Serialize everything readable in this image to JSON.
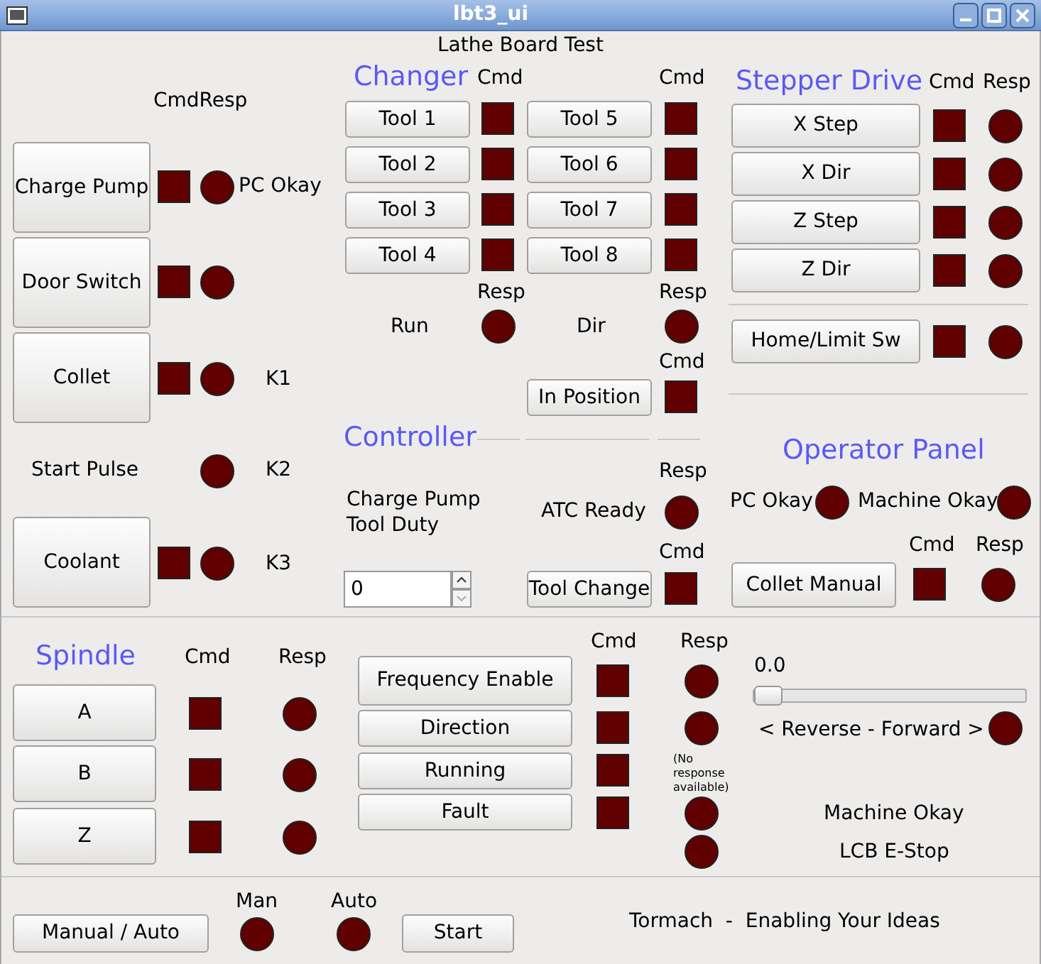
{
  "window": {
    "title": "lbt3_ui"
  },
  "heading": "Lathe Board Test",
  "widgets": [
    {
      "kind": "label",
      "text": "CmdResp"
    },
    {
      "kind": "button",
      "text": "Charge Pump"
    },
    {
      "kind": "cmd",
      "on": false
    },
    {
      "kind": "lamp",
      "on": false
    },
    {
      "kind": "label",
      "text": "PC Okay"
    },
    {
      "kind": "heading",
      "text": "Changer"
    },
    {
      "kind": "label",
      "text": "Cmd"
    },
    {
      "kind": "label",
      "text": "Cmd"
    },
    {
      "kind": "button",
      "text": "Tool 1"
    },
    {
      "kind": "cmd",
      "on": false
    },
    {
      "kind": "button",
      "text": "Tool 5"
    },
    {
      "kind": "cmd",
      "on": false
    },
    {
      "kind": "button",
      "text": "Tool 2"
    },
    {
      "kind": "cmd",
      "on": false
    },
    {
      "kind": "button",
      "text": "Tool 6"
    },
    {
      "kind": "cmd",
      "on": false
    },
    {
      "kind": "button",
      "text": "Tool 3"
    },
    {
      "kind": "cmd",
      "on": false
    },
    {
      "kind": "button",
      "text": "Tool 7"
    },
    {
      "kind": "cmd",
      "on": false
    },
    {
      "kind": "button",
      "text": "Tool 4"
    },
    {
      "kind": "cmd",
      "on": false
    },
    {
      "kind": "button",
      "text": "Tool 8"
    },
    {
      "kind": "cmd",
      "on": false
    },
    {
      "kind": "heading",
      "text": "Stepper Drive"
    },
    {
      "kind": "label",
      "text": "Cmd"
    },
    {
      "kind": "label",
      "text": "Resp"
    },
    {
      "kind": "button",
      "text": "X Step"
    },
    {
      "kind": "cmd",
      "on": false
    },
    {
      "kind": "lamp",
      "on": false
    },
    {
      "kind": "button",
      "text": "X Dir"
    },
    {
      "kind": "cmd",
      "on": false
    },
    {
      "kind": "lamp",
      "on": false
    },
    {
      "kind": "button",
      "text": "Z Step"
    },
    {
      "kind": "cmd",
      "on": false
    },
    {
      "kind": "lamp",
      "on": false
    },
    {
      "kind": "button",
      "text": "Z Dir"
    },
    {
      "kind": "cmd",
      "on": false
    },
    {
      "kind": "lamp",
      "on": false
    },
    {
      "kind": "button",
      "text": "Door Switch"
    },
    {
      "kind": "cmd",
      "on": false
    },
    {
      "kind": "lamp",
      "on": false
    },
    {
      "kind": "label",
      "text": "Resp"
    },
    {
      "kind": "label",
      "text": "Resp"
    },
    {
      "kind": "label",
      "text": "Run"
    },
    {
      "kind": "lamp",
      "on": false
    },
    {
      "kind": "label",
      "text": "Dir"
    },
    {
      "kind": "lamp",
      "on": false
    },
    {
      "kind": "button",
      "text": "Home/Limit Sw"
    },
    {
      "kind": "cmd",
      "on": false
    },
    {
      "kind": "lamp",
      "on": false
    },
    {
      "kind": "button",
      "text": "Collet"
    },
    {
      "kind": "cmd",
      "on": false
    },
    {
      "kind": "lamp",
      "on": false
    },
    {
      "kind": "label",
      "text": "K1"
    },
    {
      "kind": "label",
      "text": "Cmd"
    },
    {
      "kind": "button",
      "text": "In Position"
    },
    {
      "kind": "cmd",
      "on": false
    },
    {
      "kind": "heading",
      "text": "Controller"
    },
    {
      "kind": "heading",
      "text": "Operator Panel"
    },
    {
      "kind": "label",
      "text": "Start Pulse"
    },
    {
      "kind": "lamp",
      "on": false
    },
    {
      "kind": "label",
      "text": "K2"
    },
    {
      "kind": "label",
      "text": "Resp"
    },
    {
      "kind": "label",
      "text": "Charge Pump Tool Duty"
    },
    {
      "kind": "label",
      "text": "ATC Ready"
    },
    {
      "kind": "lamp",
      "on": false
    },
    {
      "kind": "label",
      "text": "PC Okay"
    },
    {
      "kind": "lamp",
      "on": false
    },
    {
      "kind": "label",
      "text": "Machine Okay"
    },
    {
      "kind": "lamp",
      "on": false
    },
    {
      "kind": "label",
      "text": "Cmd"
    },
    {
      "kind": "label",
      "text": "Resp"
    },
    {
      "kind": "button",
      "text": "Coolant"
    },
    {
      "kind": "cmd",
      "on": false
    },
    {
      "kind": "lamp",
      "on": false
    },
    {
      "kind": "label",
      "text": "K3"
    },
    {
      "kind": "label",
      "text": "Cmd"
    },
    {
      "kind": "spin",
      "value": "0"
    },
    {
      "kind": "button",
      "text": "Tool Change"
    },
    {
      "kind": "cmd",
      "on": false
    },
    {
      "kind": "button",
      "text": "Collet Manual"
    },
    {
      "kind": "cmd",
      "on": false
    },
    {
      "kind": "lamp",
      "on": false
    },
    {
      "kind": "heading",
      "text": "Spindle"
    },
    {
      "kind": "label",
      "text": "Cmd"
    },
    {
      "kind": "label",
      "text": "Resp"
    },
    {
      "kind": "label",
      "text": "Cmd"
    },
    {
      "kind": "label",
      "text": "Resp"
    },
    {
      "kind": "button",
      "text": "Frequency Enable"
    },
    {
      "kind": "cmd",
      "on": false
    },
    {
      "kind": "lamp",
      "on": false
    },
    {
      "kind": "label",
      "text": "0.0"
    },
    {
      "kind": "slider",
      "level": 0
    },
    {
      "kind": "button",
      "text": "A"
    },
    {
      "kind": "cmd",
      "on": false
    },
    {
      "kind": "lamp",
      "on": false
    },
    {
      "kind": "button",
      "text": "Direction"
    },
    {
      "kind": "cmd",
      "on": false
    },
    {
      "kind": "lamp",
      "on": false
    },
    {
      "kind": "label",
      "text": "< Reverse - Forward >"
    },
    {
      "kind": "lamp",
      "on": false
    },
    {
      "kind": "button",
      "text": "B"
    },
    {
      "kind": "cmd",
      "on": false
    },
    {
      "kind": "lamp",
      "on": false
    },
    {
      "kind": "button",
      "text": "Running"
    },
    {
      "kind": "cmd",
      "on": false
    },
    {
      "kind": "note",
      "text": "(No response available)"
    },
    {
      "kind": "button",
      "text": "Fault"
    },
    {
      "kind": "cmd",
      "on": false
    },
    {
      "kind": "lamp",
      "on": false
    },
    {
      "kind": "label",
      "text": "Machine Okay"
    },
    {
      "kind": "button",
      "text": "Z"
    },
    {
      "kind": "cmd",
      "on": false
    },
    {
      "kind": "lamp",
      "on": false
    },
    {
      "kind": "lamp",
      "on": false
    },
    {
      "kind": "label",
      "text": "LCB E-Stop"
    },
    {
      "kind": "label",
      "text": "Man"
    },
    {
      "kind": "label",
      "text": "Auto"
    },
    {
      "kind": "button",
      "text": "Manual / Auto"
    },
    {
      "kind": "lamp",
      "on": false
    },
    {
      "kind": "lamp",
      "on": false
    },
    {
      "kind": "button",
      "text": "Start"
    },
    {
      "kind": "label",
      "text": "Tormach  -  Enabling Your Ideas"
    }
  ]
}
